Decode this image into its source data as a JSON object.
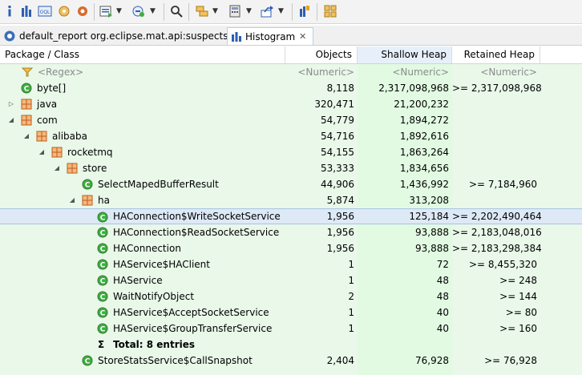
{
  "toolbar": {
    "icons": [
      "info-icon",
      "histogram-icon",
      "oql-icon",
      "heap-dump-overview-icon",
      "query-browser-icon",
      "find-object-icon",
      "search-icon",
      "group-by-icon",
      "calculate-retained-icon",
      "export-icon",
      "pin-icon",
      "package-icon"
    ]
  },
  "tabs": [
    {
      "label": "default_report  org.eclipse.mat.api:suspects",
      "icon": "report-icon"
    },
    {
      "label": "Histogram",
      "icon": "histogram-icon",
      "close": "✕"
    }
  ],
  "table": {
    "columns": [
      "Package / Class",
      "Objects",
      "Shallow Heap",
      "Retained Heap"
    ],
    "filter_row": {
      "name": "<Regex>",
      "objects": "<Numeric>",
      "shallow": "<Numeric>",
      "retained": "<Numeric>"
    },
    "rows": [
      {
        "name": "byte[]",
        "type": "class",
        "objects": "8,118",
        "shallow": "2,317,098,968",
        "retained": ">= 2,317,098,968"
      },
      {
        "name": "java",
        "type": "package",
        "expander": "collapsed",
        "objects": "320,471",
        "shallow": "21,200,232",
        "retained": ""
      },
      {
        "name": "com",
        "type": "package",
        "expander": "expanded",
        "objects": "54,779",
        "shallow": "1,894,272",
        "retained": ""
      },
      {
        "name": "alibaba",
        "type": "package",
        "expander": "expanded",
        "objects": "54,716",
        "shallow": "1,892,616",
        "retained": ""
      },
      {
        "name": "rocketmq",
        "type": "package",
        "expander": "expanded",
        "objects": "54,155",
        "shallow": "1,863,264",
        "retained": ""
      },
      {
        "name": "store",
        "type": "package",
        "expander": "expanded",
        "objects": "53,333",
        "shallow": "1,834,656",
        "retained": ""
      },
      {
        "name": "SelectMapedBufferResult",
        "type": "class",
        "objects": "44,906",
        "shallow": "1,436,992",
        "retained": ">= 7,184,960"
      },
      {
        "name": "ha",
        "type": "package",
        "expander": "expanded",
        "objects": "5,874",
        "shallow": "313,208",
        "retained": ""
      },
      {
        "name": "HAConnection$WriteSocketService",
        "type": "class",
        "objects": "1,956",
        "shallow": "125,184",
        "retained": ">= 2,202,490,464"
      },
      {
        "name": "HAConnection$ReadSocketService",
        "type": "class",
        "objects": "1,956",
        "shallow": "93,888",
        "retained": ">= 2,183,048,016"
      },
      {
        "name": "HAConnection",
        "type": "class",
        "objects": "1,956",
        "shallow": "93,888",
        "retained": ">= 2,183,298,384"
      },
      {
        "name": "HAService$HAClient",
        "type": "class",
        "objects": "1",
        "shallow": "72",
        "retained": ">= 8,455,320"
      },
      {
        "name": "HAService",
        "type": "class",
        "objects": "1",
        "shallow": "48",
        "retained": ">= 248"
      },
      {
        "name": "WaitNotifyObject",
        "type": "class",
        "objects": "2",
        "shallow": "48",
        "retained": ">= 144"
      },
      {
        "name": "HAService$AcceptSocketService",
        "type": "class",
        "objects": "1",
        "shallow": "40",
        "retained": ">= 80"
      },
      {
        "name": "HAService$GroupTransferService",
        "type": "class",
        "objects": "1",
        "shallow": "40",
        "retained": ">= 160"
      },
      {
        "name": "Total: 8 entries",
        "type": "total",
        "objects": "",
        "shallow": "",
        "retained": ""
      },
      {
        "name": "StoreStatsService$CallSnapshot",
        "type": "class",
        "objects": "2,404",
        "shallow": "76,928",
        "retained": ">= 76,928"
      }
    ]
  },
  "colors": {
    "class_icon": "#3fae3f",
    "package_icon": "#c8642a",
    "column_bg": "#e6f7e6",
    "sorted_column_bg": "#dff7df",
    "selected_row": "#dde9f6"
  }
}
